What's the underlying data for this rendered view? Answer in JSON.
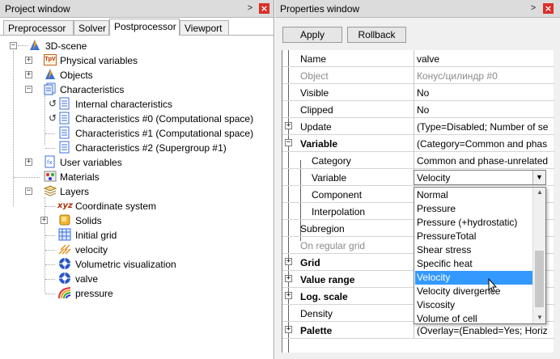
{
  "left": {
    "title": "Project window",
    "tabs": [
      "Preprocessor",
      "Solver",
      "Postprocessor",
      "Viewport"
    ],
    "active_tab": "Postprocessor",
    "tree": {
      "root": "3D-scene",
      "physical_variables": "Physical variables",
      "objects": "Objects",
      "characteristics": "Characteristics",
      "internal": "Internal characteristics",
      "char0": "Characteristics #0 (Computational space)",
      "char1": "Characteristics #1 (Computational space)",
      "char2": "Characteristics #2 (Supergroup #1)",
      "user_variables": "User variables",
      "materials": "Materials",
      "layers": "Layers",
      "coord": "Coordinate system",
      "solids": "Solids",
      "initial_grid": "Initial grid",
      "velocity": "velocity",
      "volumetric": "Volumetric visualization",
      "valve": "valve",
      "pressure": "pressure"
    },
    "icon_text": {
      "tpv": "TpV",
      "xyz": "xyz"
    }
  },
  "right": {
    "title": "Properties window",
    "apply": "Apply",
    "rollback": "Rollback",
    "rows": [
      {
        "name": "Name",
        "value": "valve"
      },
      {
        "name": "Object",
        "value": "Конус/цилиндр #0"
      },
      {
        "name": "Visible",
        "value": "No"
      },
      {
        "name": "Clipped",
        "value": "No"
      },
      {
        "name": "Update",
        "value": "(Type=Disabled; Number of se"
      },
      {
        "name": "Variable",
        "value": "(Category=Common and phas"
      },
      {
        "name": "Category",
        "value": "Common and phase-unrelated"
      },
      {
        "name": "Variable",
        "value": ""
      },
      {
        "name": "Component",
        "value": ""
      },
      {
        "name": "Interpolation",
        "value": ""
      },
      {
        "name": "Subregion",
        "value": ""
      },
      {
        "name": "On regular grid",
        "value": ""
      },
      {
        "name": "Grid",
        "value": ""
      },
      {
        "name": "Value range",
        "value": ""
      },
      {
        "name": "Log. scale",
        "value": ""
      },
      {
        "name": "Density",
        "value": ""
      },
      {
        "name": "Palette",
        "value": "(Overlay=(Enabled=Yes; Horiz."
      }
    ],
    "combo_value": "Velocity",
    "options": [
      "Normal",
      "Pressure",
      "Pressure (+hydrostatic)",
      "PressureTotal",
      "Shear stress",
      "Specific heat",
      "Velocity",
      "Velocity divergence",
      "Viscosity",
      "Volume of cell"
    ],
    "selected_option": "Velocity"
  },
  "colors": {
    "selection": "#3399ff",
    "close_button": "#d9302a",
    "titlebar": "#dcdcdc"
  },
  "icons": [
    "pin-icon",
    "close-icon",
    "scene-icon",
    "variables-icon",
    "objects-icon",
    "characteristics-icon",
    "table-icon",
    "user-variables-icon",
    "materials-icon",
    "layers-icon",
    "coordinate-icon",
    "solids-icon",
    "grid-icon",
    "vector-icon",
    "volume-icon",
    "surface-icon",
    "isoline-icon",
    "dropdown-arrow-icon",
    "mouse-cursor-icon"
  ]
}
